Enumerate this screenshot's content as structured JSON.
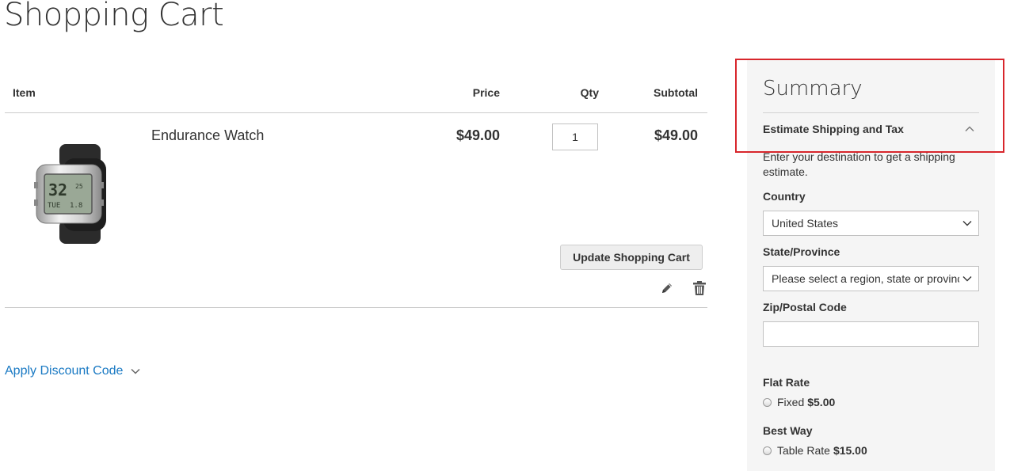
{
  "page": {
    "title": "Shopping Cart"
  },
  "cart": {
    "headers": {
      "item": "Item",
      "price": "Price",
      "qty": "Qty",
      "subtotal": "Subtotal"
    },
    "items": [
      {
        "name": "Endurance Watch",
        "price": "$49.00",
        "qty": "1",
        "subtotal": "$49.00",
        "image_icon": "watch-image"
      }
    ],
    "actions": {
      "edit_icon": "pencil-icon",
      "delete_icon": "trash-icon"
    },
    "update_label": "Update Shopping Cart",
    "discount_label": "Apply Discount Code"
  },
  "summary": {
    "title": "Summary",
    "shipping_heading": "Estimate Shipping and Tax",
    "shipping_desc": "Enter your destination to get a shipping estimate.",
    "country_label": "Country",
    "country_value": "United States",
    "state_label": "State/Province",
    "state_value": "Please select a region, state or province.",
    "zip_label": "Zip/Postal Code",
    "zip_value": "",
    "methods": [
      {
        "title": "Flat Rate",
        "rate_name": "Fixed",
        "rate_price": "$5.00"
      },
      {
        "title": "Best Way",
        "rate_name": "Table Rate",
        "rate_price": "$15.00"
      }
    ]
  },
  "colors": {
    "link": "#1979c3",
    "highlight": "#d8262c",
    "summary_bg": "#f5f5f5"
  }
}
